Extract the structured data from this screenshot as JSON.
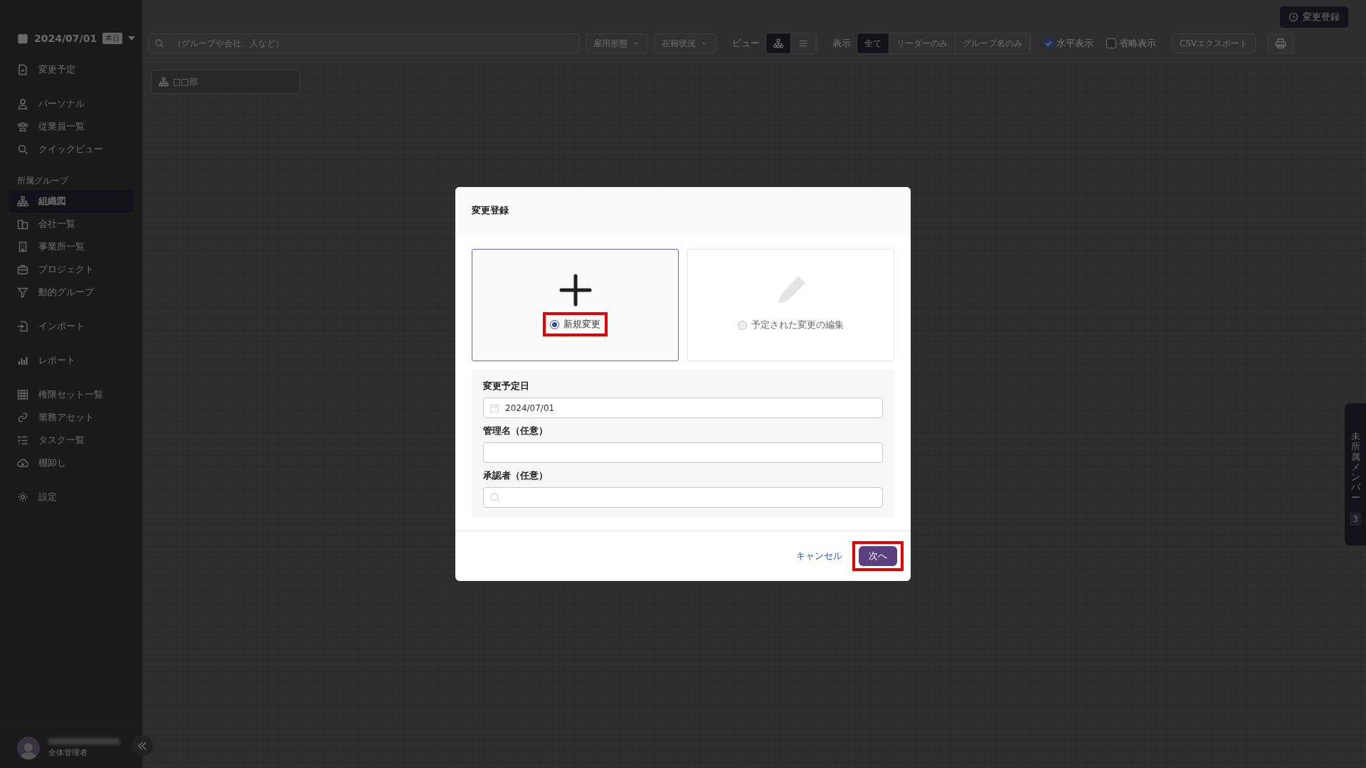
{
  "sidebar": {
    "date": "2024/07/01",
    "today_badge": "本日",
    "groups": [
      {
        "items": [
          {
            "label": "変更予定",
            "selected": false
          }
        ]
      },
      {
        "items": [
          {
            "label": "パーソナル",
            "selected": false
          },
          {
            "label": "従業員一覧",
            "selected": false
          },
          {
            "label": "クイックビュー",
            "selected": false
          }
        ]
      },
      {
        "heading": "所属グループ",
        "items": [
          {
            "label": "組織図",
            "selected": true
          },
          {
            "label": "会社一覧",
            "selected": false
          },
          {
            "label": "事業所一覧",
            "selected": false
          },
          {
            "label": "プロジェクト",
            "selected": false
          },
          {
            "label": "動的グループ",
            "selected": false
          }
        ]
      },
      {
        "items": [
          {
            "label": "インポート",
            "selected": false
          }
        ]
      },
      {
        "items": [
          {
            "label": "レポート",
            "selected": false
          }
        ]
      },
      {
        "items": [
          {
            "label": "権限セット一覧",
            "selected": false
          },
          {
            "label": "業務アセット",
            "selected": false
          },
          {
            "label": "タスク一覧",
            "selected": false
          },
          {
            "label": "棚卸し",
            "selected": false
          }
        ]
      },
      {
        "items": [
          {
            "label": "設定",
            "selected": false
          }
        ]
      }
    ],
    "user": {
      "role": "全体管理者"
    }
  },
  "header": {
    "register_button": "変更登録"
  },
  "toolbar": {
    "search": {
      "placeholder": "（グループや会社、人など）"
    },
    "filters": [
      "雇用形態",
      "在籍状況"
    ],
    "view_label": "ビュー",
    "views": [
      {
        "selected": true
      },
      {
        "selected": false
      }
    ],
    "display_label": "表示",
    "display_options": [
      {
        "label": "全て",
        "selected": true
      },
      {
        "label": "リーダーのみ",
        "selected": false
      },
      {
        "label": "グループ名のみ",
        "selected": false
      }
    ],
    "checkboxes": [
      {
        "label": "水平表示",
        "checked": true
      },
      {
        "label": "省略表示",
        "checked": false
      }
    ],
    "export_button": "CSVエクスポート"
  },
  "org_chart": {
    "nodes": [
      {
        "label": "□□部"
      }
    ]
  },
  "side_tab": {
    "label": "未所属メンバー",
    "count": "3"
  },
  "dialog": {
    "title": "変更登録",
    "options": [
      {
        "label": "新規変更",
        "selected": true,
        "highlighted": true
      },
      {
        "label": "予定された変更の編集",
        "selected": false,
        "highlighted": false
      }
    ],
    "fields": [
      {
        "label": "変更予定日",
        "value": "2024/07/01",
        "kind": "date"
      },
      {
        "label": "管理名（任意）",
        "kind": "text"
      },
      {
        "label": "承認者（任意）",
        "kind": "search"
      }
    ],
    "cancel": "キャンセル",
    "next": {
      "label": "次へ",
      "highlighted": true
    }
  }
}
